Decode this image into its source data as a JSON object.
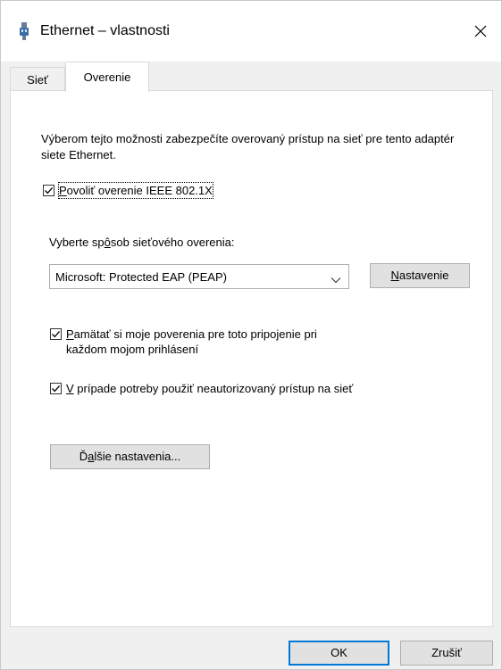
{
  "window": {
    "title": "Ethernet – vlastnosti",
    "close_label": "✕"
  },
  "tabs": [
    {
      "label": "Sieť",
      "active": false
    },
    {
      "label": "Overenie",
      "active": true
    }
  ],
  "content": {
    "description": "Výberom tejto možnosti zabezpečíte overovaný prístup na sieť pre tento adaptér siete Ethernet.",
    "enable_8021x": {
      "checked": true,
      "label_prefix": "P",
      "label_rest": "ovoliť overenie IEEE 802.1X"
    },
    "method_label": "Vyberte spôsob sieťového overenia:",
    "method_label_pre": "Vyberte sp",
    "method_label_u": "ô",
    "method_label_post": "sob sieťového overenia:",
    "method_select": {
      "value": "Microsoft: Protected EAP (PEAP)"
    },
    "settings_button": {
      "u": "N",
      "rest": "astavenie"
    },
    "remember_credentials": {
      "checked": true,
      "u": "P",
      "rest": "amätať si moje poverenia pre toto pripojenie pri každom mojom prihlásení"
    },
    "fallback_unauthorized": {
      "checked": true,
      "u": "V",
      "rest": " prípade potreby použiť neautorizovaný prístup na sieť"
    },
    "more_settings_button": {
      "pre": "Ď",
      "u": "a",
      "rest": "lšie nastavenia..."
    }
  },
  "footer": {
    "ok_label": "OK",
    "cancel_label": "Zrušiť"
  },
  "colors": {
    "accent": "#0078d7",
    "panel_bg": "#ffffff",
    "window_bg": "#f0f0f0"
  }
}
